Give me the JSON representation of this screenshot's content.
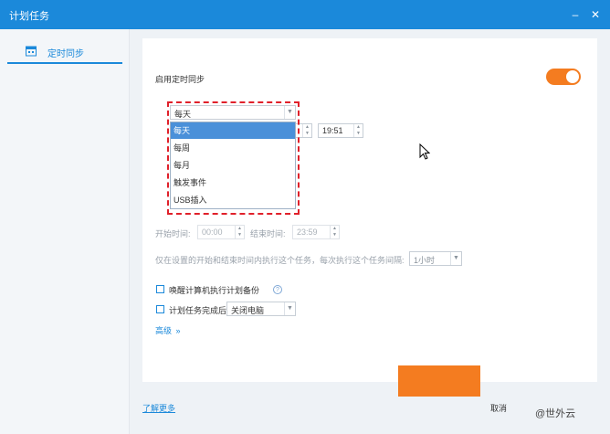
{
  "window": {
    "title": "计划任务"
  },
  "sidebar": {
    "items": [
      {
        "label": "定时同步"
      }
    ]
  },
  "panel": {
    "enable_label": "启用定时同步",
    "frequency": {
      "selected": "每天",
      "options": [
        "每天",
        "每周",
        "每月",
        "触发事件",
        "USB插入"
      ]
    },
    "time_value": "19:51",
    "start_label": "开始时间:",
    "start_value": "00:00",
    "end_label": "结束时间:",
    "end_value": "23:59",
    "repeat_text": "仅在设置的开始和结束时间内执行这个任务，每次执行这个任务间隔:",
    "interval_value": "1小时",
    "wake_label": "唤醒计算机执行计划备份",
    "after_label": "计划任务完成后",
    "after_value": "关闭电脑",
    "advanced_label": "高级"
  },
  "footer": {
    "learn_more": "了解更多",
    "cancel": "取消"
  },
  "watermark": "@世外云",
  "colors": {
    "accent": "#1b89da",
    "toggle": "#f47c20",
    "highlight": "#e0202a"
  }
}
